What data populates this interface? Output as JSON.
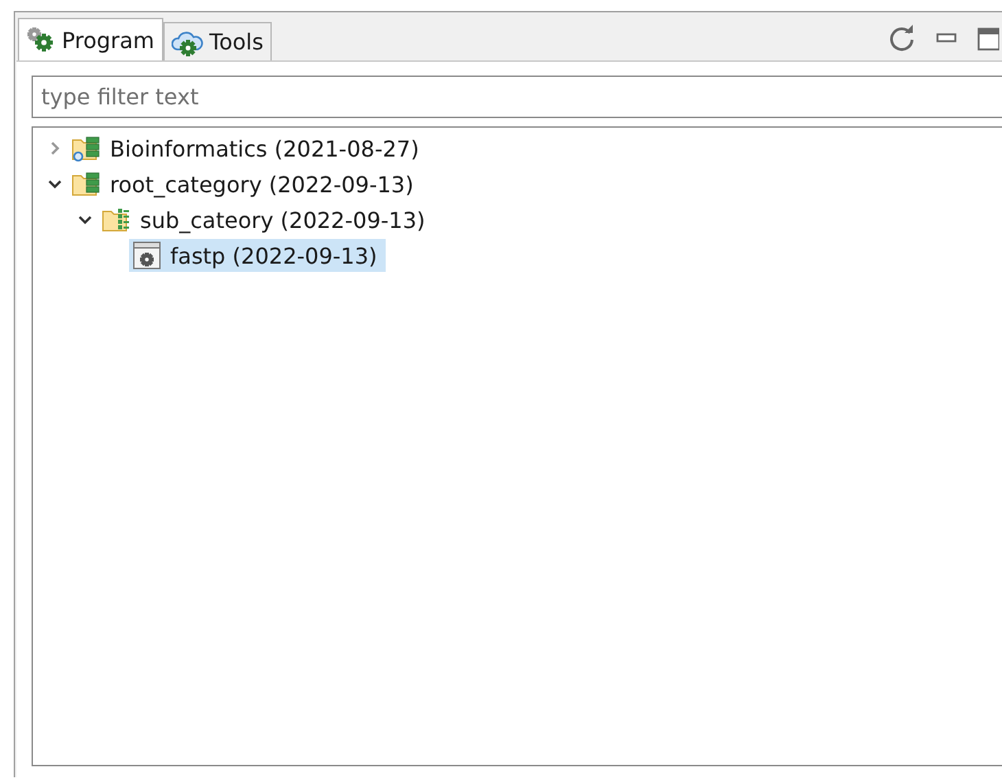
{
  "tabs": [
    {
      "label": "Program",
      "kind": "program",
      "selected": true
    },
    {
      "label": "Tools",
      "kind": "tools",
      "selected": false
    }
  ],
  "filter": {
    "placeholder": "type filter text"
  },
  "tree": [
    {
      "label": "Bioinformatics (2021-08-27)",
      "kind": "linked-folder",
      "expanded": false,
      "selected": false
    },
    {
      "label": "root_category (2022-09-13)",
      "kind": "db-folder",
      "expanded": true,
      "selected": false,
      "children": [
        {
          "label": "sub_cateory (2022-09-13)",
          "kind": "list-folder",
          "expanded": true,
          "selected": false,
          "children": [
            {
              "label": "fastp (2022-09-13)",
              "kind": "app",
              "selected": true
            }
          ]
        }
      ]
    }
  ]
}
